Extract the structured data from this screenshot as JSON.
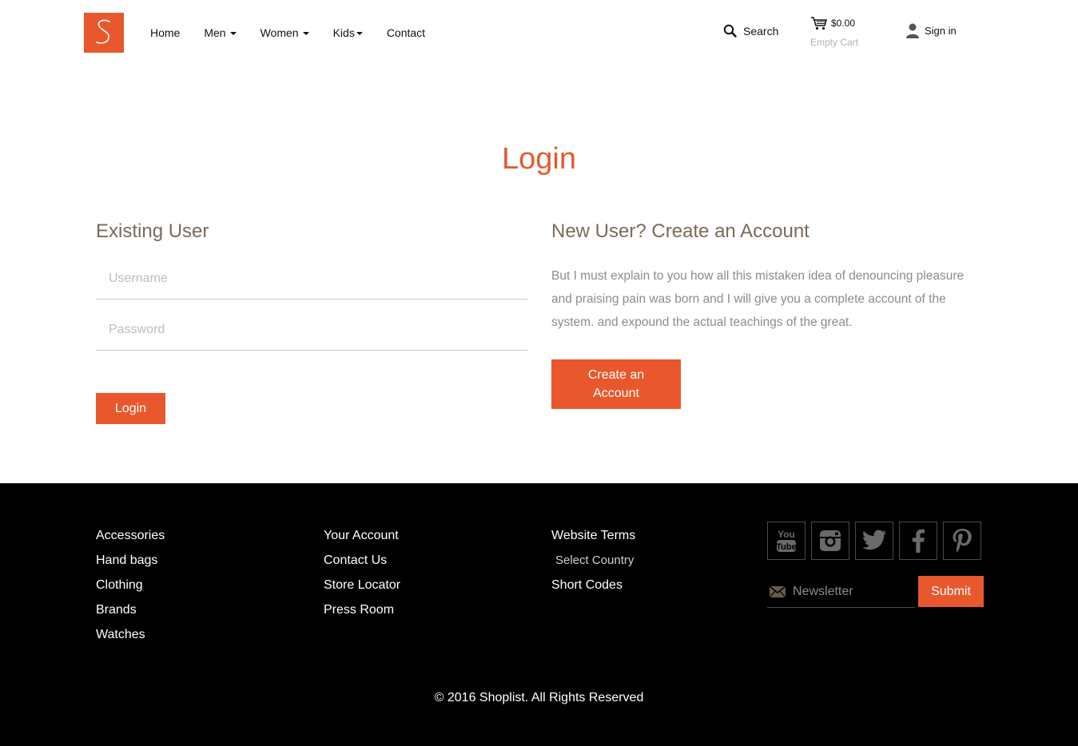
{
  "header": {
    "nav": [
      {
        "label": "Home",
        "dropdown": false
      },
      {
        "label": "Men",
        "dropdown": true
      },
      {
        "label": "Women",
        "dropdown": true
      },
      {
        "label": "Kids",
        "dropdown": true
      },
      {
        "label": "Contact",
        "dropdown": false
      }
    ],
    "search_label": "Search",
    "cart_total": "$0.00",
    "cart_status": "Empty Cart",
    "signin_label": "Sign in"
  },
  "main": {
    "title": "Login",
    "existing": {
      "heading": "Existing User",
      "username_placeholder": "Username",
      "password_placeholder": "Password",
      "login_label": "Login"
    },
    "new_user": {
      "heading": "New User? Create an Account",
      "text": "But I must explain to you how all this mistaken idea of denouncing pleasure and praising pain was born and I will give you a complete account of the system. and expound the actual teachings of the great.",
      "button_label": "Create an Account"
    }
  },
  "footer": {
    "col1": [
      "Accessories",
      "Hand bags",
      "Clothing",
      "Brands",
      "Watches"
    ],
    "col2": [
      "Your Account",
      "Contact Us",
      "Store Locator",
      "Press Room"
    ],
    "col3": [
      "Website Terms",
      "Select Country",
      "Short Codes"
    ],
    "social": [
      "youtube-icon",
      "instagram-icon",
      "twitter-icon",
      "facebook-icon",
      "pinterest-icon"
    ],
    "newsletter_placeholder": "Newsletter",
    "submit_label": "Submit",
    "copyright": "© 2016 Shoplist. All Rights Reserved"
  },
  "colors": {
    "accent": "#e8582c",
    "heading": "#7b6a5a",
    "footer_bg": "#000000"
  }
}
